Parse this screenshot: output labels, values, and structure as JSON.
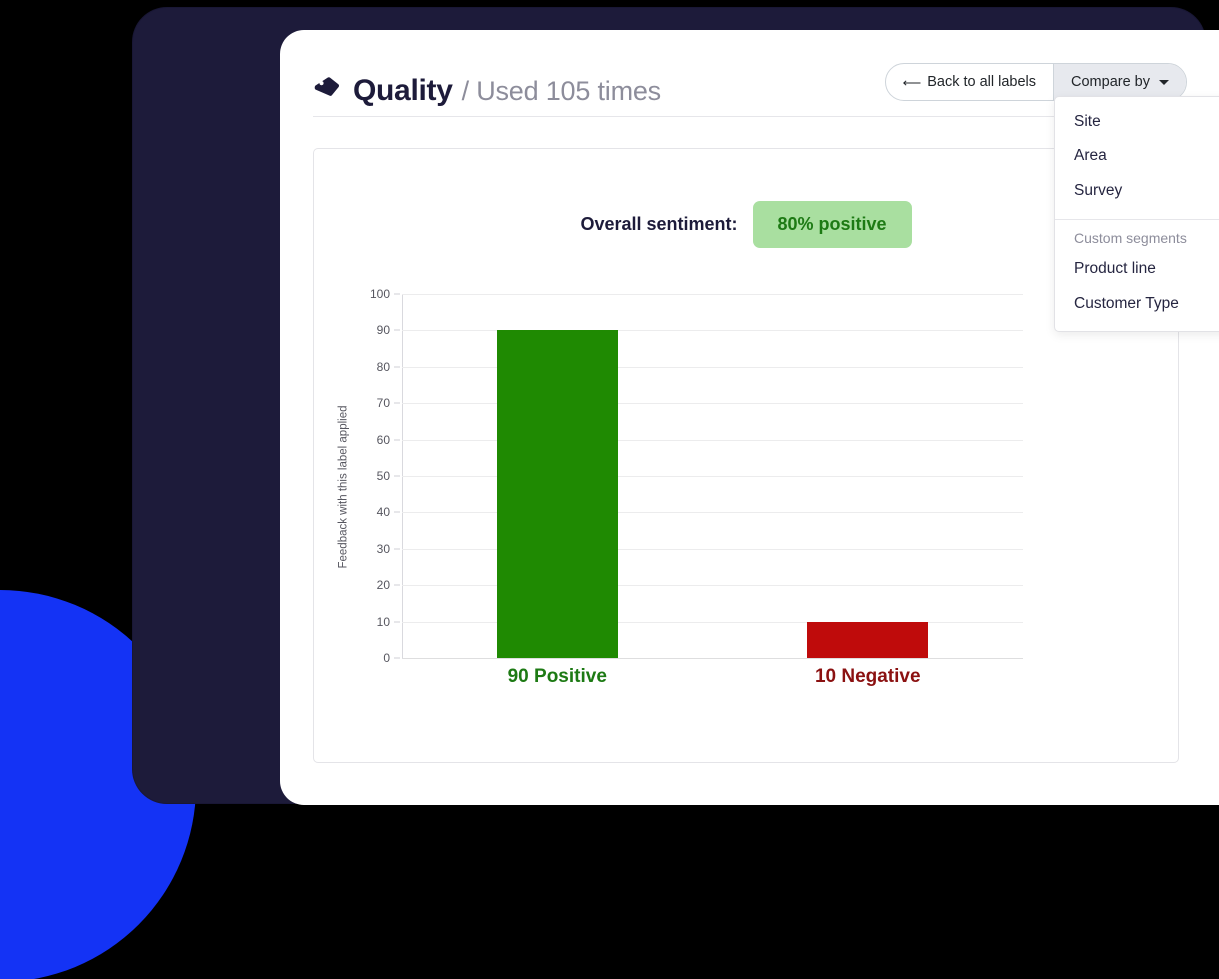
{
  "header": {
    "tag_icon": "tag-icon",
    "title": "Quality",
    "title_suffix": "/ Used 105 times",
    "back_button_label": "Back to all labels",
    "back_arrow_icon": "arrow-left-icon",
    "compare_by_label": "Compare by",
    "caret_icon": "chevron-down-icon"
  },
  "compare_by_menu": {
    "items": [
      {
        "label": "Site"
      },
      {
        "label": "Area"
      },
      {
        "label": "Survey"
      }
    ],
    "section_header": "Custom segments",
    "custom_items": [
      {
        "label": "Product line"
      },
      {
        "label": "Customer Type"
      }
    ]
  },
  "sentiment": {
    "label": "Overall sentiment:",
    "badge": "80% positive",
    "badge_bg": "#a9dfa0",
    "badge_color": "#1d7a14"
  },
  "chart_data": {
    "type": "bar",
    "title": "",
    "xlabel": "",
    "ylabel": "Feedback with this label applied",
    "ylim": [
      0,
      100
    ],
    "ytick_step": 10,
    "yticks": [
      "100",
      "90",
      "80",
      "70",
      "60",
      "50",
      "40",
      "30",
      "20",
      "10",
      "0"
    ],
    "grid": true,
    "legend": "none",
    "categories": [
      "90 Positive",
      "10 Negative"
    ],
    "values": [
      90,
      10
    ],
    "colors": [
      "#1f8a02",
      "#bf0b0b"
    ],
    "bars": [
      {
        "label": "90 Positive",
        "value": 90,
        "color": "#1f8a02",
        "label_color": "#1d7a14"
      },
      {
        "label": "10 Negative",
        "value": 10,
        "color": "#bf0b0b",
        "label_color": "#8b1111"
      }
    ]
  },
  "theme": {
    "frame_color": "#1d1b3a",
    "accent_blue": "#1433f5",
    "card_bg": "#ffffff"
  }
}
